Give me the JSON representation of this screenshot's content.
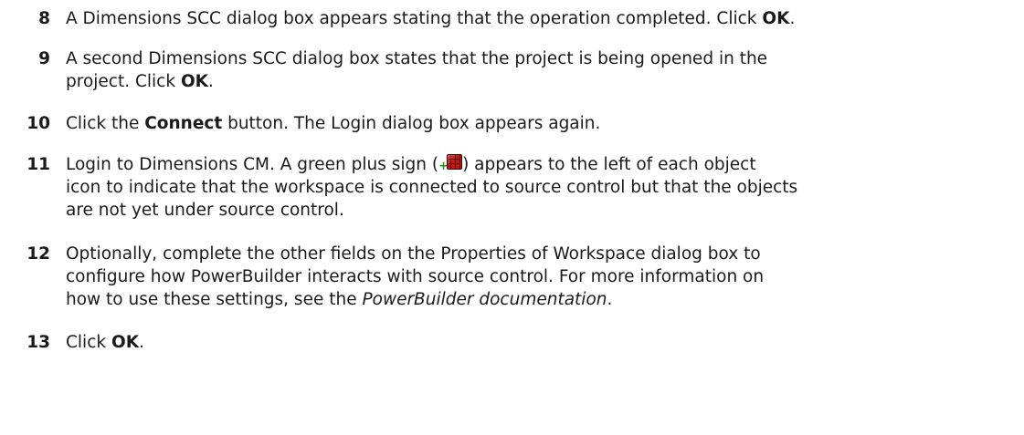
{
  "steps": [
    {
      "number": "8",
      "parts": [
        {
          "text": "A Dimensions SCC dialog box appears stating that the operation completed. Click "
        },
        {
          "text": "OK",
          "bold": true
        },
        {
          "text": "."
        }
      ]
    },
    {
      "number": "9",
      "parts": [
        {
          "text": "A second Dimensions SCC dialog box states that the project is being opened in the"
        },
        {
          "br": true
        },
        {
          "text": "project. Click "
        },
        {
          "text": "OK",
          "bold": true
        },
        {
          "text": "."
        }
      ]
    },
    {
      "number": "10",
      "parts": [
        {
          "text": "Click the "
        },
        {
          "text": "Connect",
          "bold": true
        },
        {
          "text": " button. The Login dialog box appears again."
        }
      ]
    },
    {
      "number": "11",
      "parts": [
        {
          "text": "Login to Dimensions CM. A green plus sign ("
        },
        {
          "icon": "green-plus-object-icon"
        },
        {
          "text": ") appears to the left of each object"
        },
        {
          "br": true
        },
        {
          "text": "icon to indicate that the workspace is connected to source control but that the objects"
        },
        {
          "br": true
        },
        {
          "text": "are not yet under source control."
        }
      ]
    },
    {
      "number": "12",
      "parts": [
        {
          "text": "Optionally, complete the other fields on the Properties of Workspace dialog box to"
        },
        {
          "br": true
        },
        {
          "text": "configure how PowerBuilder interacts with source control. For more information on"
        },
        {
          "br": true
        },
        {
          "text": "how to use these settings, see the "
        },
        {
          "text": "PowerBuilder documentation",
          "italic": true
        },
        {
          "text": "."
        }
      ]
    },
    {
      "number": "13",
      "parts": [
        {
          "text": "Click "
        },
        {
          "text": "OK",
          "bold": true
        },
        {
          "text": "."
        }
      ]
    }
  ]
}
